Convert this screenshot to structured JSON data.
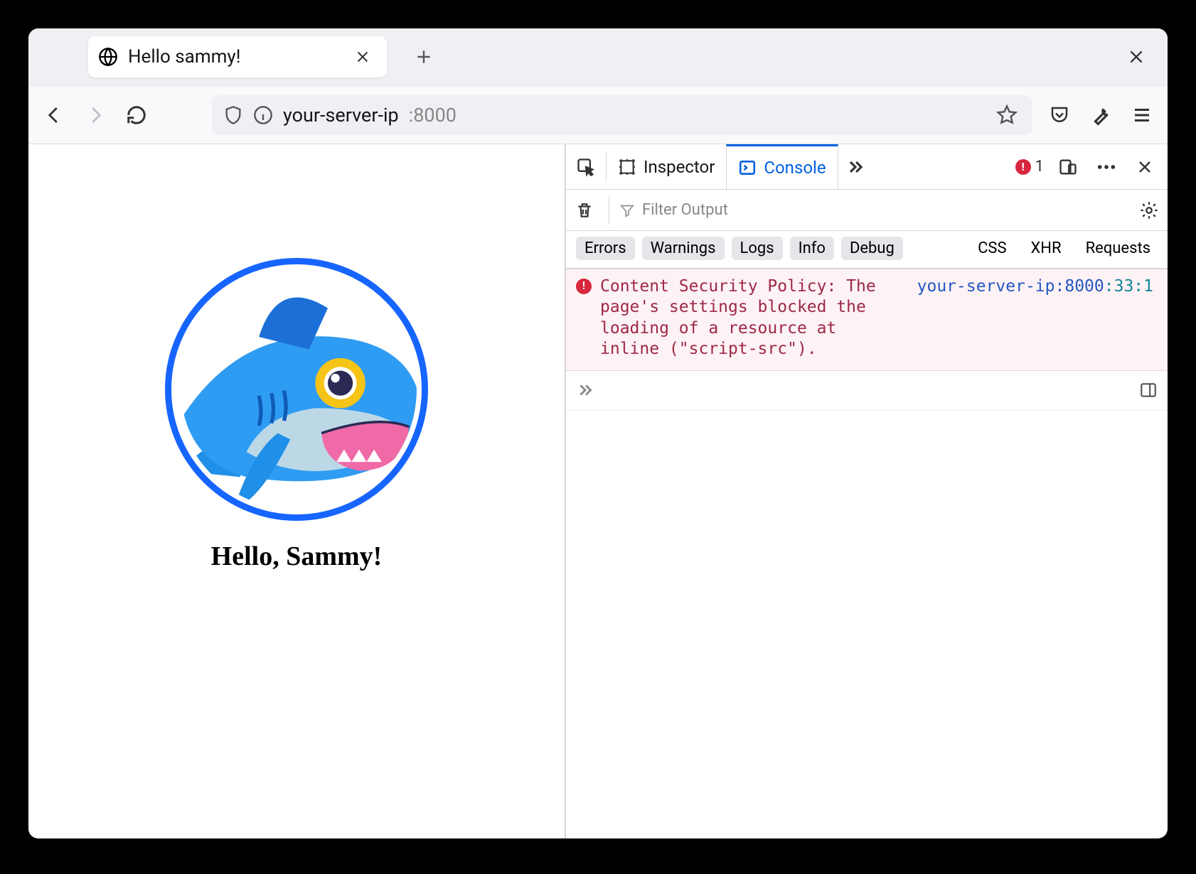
{
  "tab": {
    "title": "Hello sammy!"
  },
  "url": {
    "host": "your-server-ip",
    "port": ":8000"
  },
  "page": {
    "greeting": "Hello, Sammy!"
  },
  "devtools": {
    "tabs": {
      "inspector": "Inspector",
      "console": "Console"
    },
    "error_count": "1",
    "filter_placeholder": "Filter Output",
    "categories": {
      "errors": "Errors",
      "warnings": "Warnings",
      "logs": "Logs",
      "info": "Info",
      "debug": "Debug",
      "css": "CSS",
      "xhr": "XHR",
      "requests": "Requests"
    },
    "message": {
      "text": "Content Security Policy: The page's settings blocked the loading of a resource at inline (\"script-src\").",
      "source_host": "your-server-ip:8000",
      "source_loc": ":33:1"
    }
  }
}
